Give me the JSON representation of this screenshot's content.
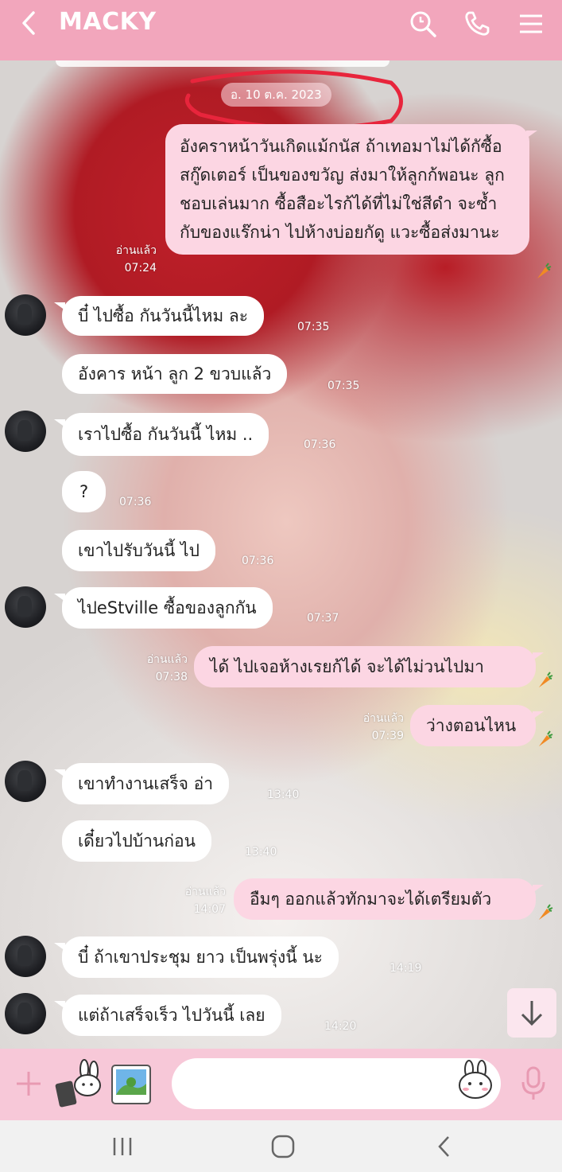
{
  "header": {
    "title": "MACKY"
  },
  "date_label": "อ. 10 ต.ค. 2023",
  "messages": [
    {
      "side": "right",
      "text": "อังคราหน้าวันเกิดแม้กนัส ถ้าเทอมาไม่ได้กัซื้อ สกู๊ดเตอร์ เป็นของขวัญ ส่งมาให้ลูกก้พอนะ ลูกชอบเล่นมาก ซื้อสือะไรก้ได้ที่ไม่ใช่สีดำ จะซ้ำกับของแร๊กน่า ไปห้างบ่อยกัดู แวะซื้อส่งมานะ",
      "read": "อ่านแล้ว",
      "time": "07:24"
    },
    {
      "side": "left",
      "text": "บี๋ ไปซื้อ กันวันนี้ไหม ละ",
      "time": "07:35"
    },
    {
      "side": "left",
      "text": "อังคาร หน้า ลูก 2 ขวบแล้ว",
      "time": "07:35"
    },
    {
      "side": "left",
      "text": "เราไปซื้อ กันวันนี้ ไหม ..",
      "time": "07:36"
    },
    {
      "side": "left",
      "text": "?",
      "time": "07:36"
    },
    {
      "side": "left",
      "text": "เขาไปรับวันนี้ ไป",
      "time": "07:36"
    },
    {
      "side": "left",
      "text": "ไปeStville ซื้อของลูกกัน",
      "time": "07:37"
    },
    {
      "side": "right",
      "text": "ได้ ไปเจอห้างเรยก้ได้ จะได้ไม่วนไปมา",
      "read": "อ่านแล้ว",
      "time": "07:38"
    },
    {
      "side": "right",
      "text": "ว่างตอนไหน",
      "read": "อ่านแล้ว",
      "time": "07:39"
    },
    {
      "side": "left",
      "text": "เขาทำงานเสร็จ อ่า",
      "time": "13:40"
    },
    {
      "side": "left",
      "text": "เดี๋ยวไปบ้านก่อน",
      "time": "13:40"
    },
    {
      "side": "right",
      "text": "อืมๆ ออกแล้วทักมาจะได้เตรียมตัว",
      "read": "อ่านแล้ว",
      "time": "14:07"
    },
    {
      "side": "left",
      "text": "บี๋ ถ้าเขาประชุม ยาว เป็นพรุ่งนี้ นะ",
      "time": "14:19"
    },
    {
      "side": "left",
      "text": "แต่ถ้าเสร็จเร็ว ไปวันนี้ เลย",
      "time": "14:20"
    }
  ],
  "input": {
    "placeholder": ""
  },
  "icons": {
    "header": [
      "back-icon",
      "search-icon",
      "phone-icon",
      "menu-icon"
    ],
    "input_bar": [
      "plus-icon",
      "sticker-icon",
      "photo-icon",
      "emoji-icon",
      "microphone-icon"
    ],
    "nav": [
      "recent-apps-icon",
      "home-icon",
      "back-nav-icon"
    ]
  },
  "colors": {
    "header": "#f2a6bc",
    "input_bar": "#f7c8d8",
    "bubble_right": "#fcd6e3",
    "bubble_left": "#ffffff",
    "annotation": "#e8253c"
  }
}
